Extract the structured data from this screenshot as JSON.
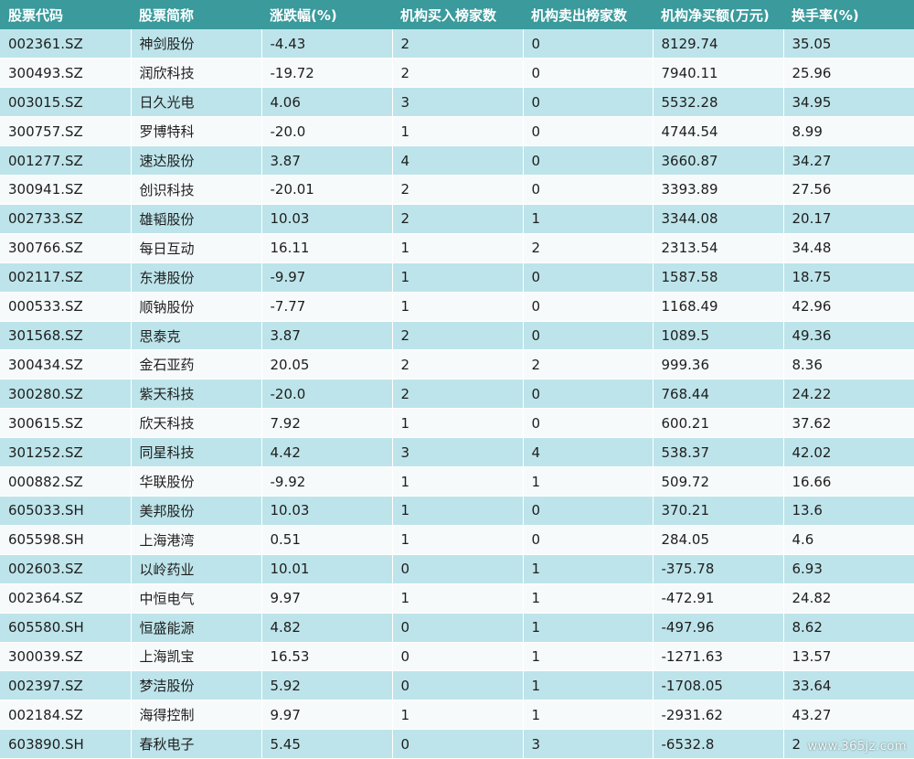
{
  "table": {
    "columns": [
      "股票代码",
      "股票简称",
      "涨跌幅(%)",
      "机构买入榜家数",
      "机构卖出榜家数",
      "机构净买额(万元)",
      "换手率(%)"
    ],
    "rows": [
      [
        "002361.SZ",
        "神剑股份",
        "-4.43",
        "2",
        "0",
        "8129.74",
        "35.05"
      ],
      [
        "300493.SZ",
        "润欣科技",
        "-19.72",
        "2",
        "0",
        "7940.11",
        "25.96"
      ],
      [
        "003015.SZ",
        "日久光电",
        "4.06",
        "3",
        "0",
        "5532.28",
        "34.95"
      ],
      [
        "300757.SZ",
        "罗博特科",
        "-20.0",
        "1",
        "0",
        "4744.54",
        "8.99"
      ],
      [
        "001277.SZ",
        "速达股份",
        "3.87",
        "4",
        "0",
        "3660.87",
        "34.27"
      ],
      [
        "300941.SZ",
        "创识科技",
        "-20.01",
        "2",
        "0",
        "3393.89",
        "27.56"
      ],
      [
        "002733.SZ",
        "雄韬股份",
        "10.03",
        "2",
        "1",
        "3344.08",
        "20.17"
      ],
      [
        "300766.SZ",
        "每日互动",
        "16.11",
        "1",
        "2",
        "2313.54",
        "34.48"
      ],
      [
        "002117.SZ",
        "东港股份",
        "-9.97",
        "1",
        "0",
        "1587.58",
        "18.75"
      ],
      [
        "000533.SZ",
        "顺钠股份",
        "-7.77",
        "1",
        "0",
        "1168.49",
        "42.96"
      ],
      [
        "301568.SZ",
        "思泰克",
        "3.87",
        "2",
        "0",
        "1089.5",
        "49.36"
      ],
      [
        "300434.SZ",
        "金石亚药",
        "20.05",
        "2",
        "2",
        "999.36",
        "8.36"
      ],
      [
        "300280.SZ",
        "紫天科技",
        "-20.0",
        "2",
        "0",
        "768.44",
        "24.22"
      ],
      [
        "300615.SZ",
        "欣天科技",
        "7.92",
        "1",
        "0",
        "600.21",
        "37.62"
      ],
      [
        "301252.SZ",
        "同星科技",
        "4.42",
        "3",
        "4",
        "538.37",
        "42.02"
      ],
      [
        "000882.SZ",
        "华联股份",
        "-9.92",
        "1",
        "1",
        "509.72",
        "16.66"
      ],
      [
        "605033.SH",
        "美邦股份",
        "10.03",
        "1",
        "0",
        "370.21",
        "13.6"
      ],
      [
        "605598.SH",
        "上海港湾",
        "0.51",
        "1",
        "0",
        "284.05",
        "4.6"
      ],
      [
        "002603.SZ",
        "以岭药业",
        "10.01",
        "0",
        "1",
        "-375.78",
        "6.93"
      ],
      [
        "002364.SZ",
        "中恒电气",
        "9.97",
        "1",
        "1",
        "-472.91",
        "24.82"
      ],
      [
        "605580.SH",
        "恒盛能源",
        "4.82",
        "0",
        "1",
        "-497.96",
        "8.62"
      ],
      [
        "300039.SZ",
        "上海凯宝",
        "16.53",
        "0",
        "1",
        "-1271.63",
        "13.57"
      ],
      [
        "002397.SZ",
        "梦洁股份",
        "5.92",
        "0",
        "1",
        "-1708.05",
        "33.64"
      ],
      [
        "002184.SZ",
        "海得控制",
        "9.97",
        "1",
        "1",
        "-2931.62",
        "43.27"
      ],
      [
        "603890.SH",
        "春秋电子",
        "5.45",
        "0",
        "3",
        "-6532.8",
        "2"
      ]
    ]
  },
  "watermark": "www.365jz.com",
  "colors": {
    "header_bg": "#3a9a9c",
    "row_odd": "#bde4ea",
    "row_even": "#f7fafb"
  }
}
